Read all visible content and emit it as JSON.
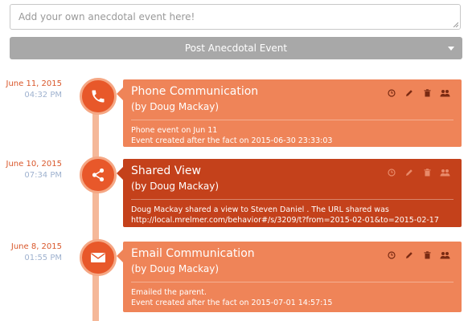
{
  "composer": {
    "placeholder": "Add your own anecdotal event here!",
    "post_label": "Post Anecdotal Event"
  },
  "colors": {
    "accent": "#e8582a",
    "card_default": "#ef8458",
    "card_highlight": "#c4411b",
    "date_color": "#d9572a",
    "time_color": "#9fb2cf",
    "timeline_line": "#f5b899"
  },
  "timeline": {
    "events": [
      {
        "date": "June 11, 2015",
        "time": "04:32 PM",
        "icon": "phone-icon",
        "title": "Phone Communication",
        "by": "(by Doug Mackay)",
        "body_line1": "Phone event on Jun 11",
        "body_line2": "Event created after the fact on 2015-06-30 23:33:03",
        "highlighted": false
      },
      {
        "date": "June 10, 2015",
        "time": "07:34 PM",
        "icon": "share-icon",
        "title": "Shared View",
        "by": "(by Doug Mackay)",
        "body_line1": "Doug Mackay shared a view to Steven Daniel . The URL shared was",
        "body_line2": "http://local.mrelmer.com/behavior#/s/3209/t?from=2015-02-01&to=2015-02-17",
        "highlighted": true
      },
      {
        "date": "June 8, 2015",
        "time": "01:55 PM",
        "icon": "envelope-icon",
        "title": "Email Communication",
        "by": "(by Doug Mackay)",
        "body_line1": "Emailed the parent.",
        "body_line2": "Event created after the fact on 2015-07-01 14:57:15",
        "highlighted": false
      }
    ]
  }
}
